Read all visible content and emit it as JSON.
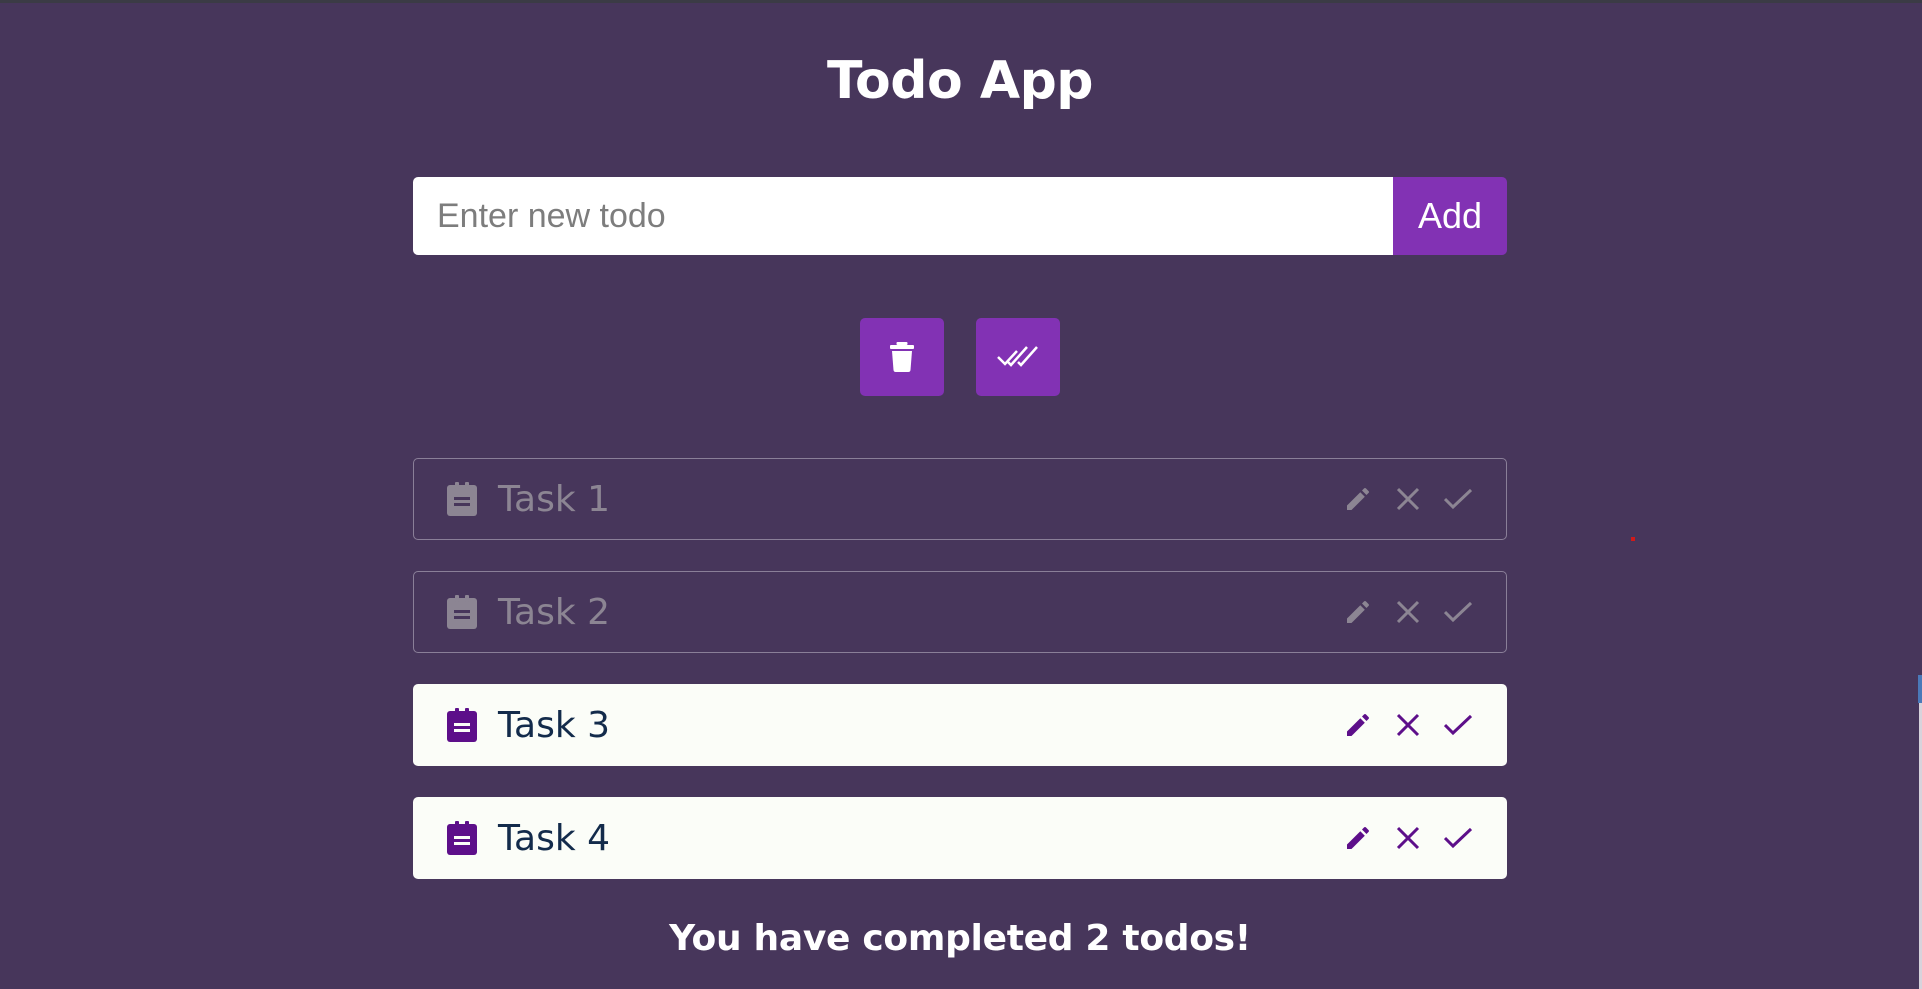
{
  "app": {
    "title": "Todo App"
  },
  "new_todo": {
    "placeholder": "Enter new todo",
    "value": "",
    "add_label": "Add"
  },
  "bulk_actions": [
    {
      "icon": "trash-icon"
    },
    {
      "icon": "double-check-icon"
    }
  ],
  "todos": [
    {
      "text": "Task 1",
      "completed": true
    },
    {
      "text": "Task 2",
      "completed": true
    },
    {
      "text": "Task 3",
      "completed": false
    },
    {
      "text": "Task 4",
      "completed": false
    }
  ],
  "item_action_icons": [
    "pencil-icon",
    "close-icon",
    "check-icon"
  ],
  "summary": "You have completed 2 todos!",
  "colors": {
    "background": "#47365b",
    "accent": "#8232b4",
    "active_item_bg": "#fbfdf8",
    "active_item_text": "#132b4b",
    "active_item_icon": "#5d0f8a",
    "completed_item_text": "#8c8593"
  }
}
